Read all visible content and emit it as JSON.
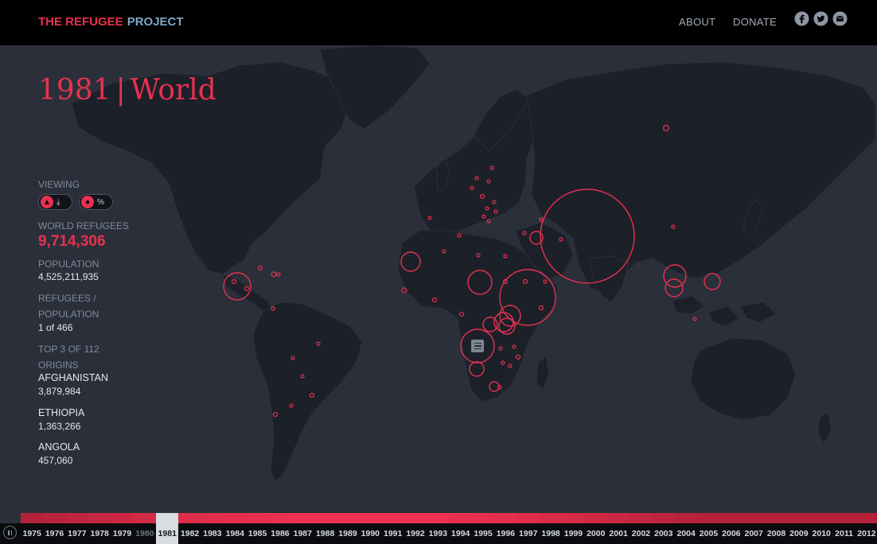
{
  "header": {
    "logo_part1": "THE REFUGEE",
    "logo_part2": "PROJECT",
    "nav": [
      "ABOUT",
      "DONATE"
    ],
    "social": [
      "facebook-icon",
      "twitter-icon",
      "email-icon"
    ]
  },
  "title": {
    "year": "1981",
    "separator": "|",
    "region": "World"
  },
  "panel": {
    "viewing_label": "VIEWING",
    "world_refugees_label": "WORLD REFUGEES",
    "world_refugees_value": "9,714,306",
    "population_label": "POPULATION",
    "population_value": "4,525,211,935",
    "ratio_label_1": "REFUGEES /",
    "ratio_label_2": "POPULATION",
    "ratio_value": "1 of 466",
    "top_label": "TOP 3 OF 112",
    "origins_label": "ORIGINS",
    "origins": [
      {
        "name": "AFGHANISTAN",
        "value": "3,879,984"
      },
      {
        "name": "ETHIOPIA",
        "value": "1,363,266"
      },
      {
        "name": "ANGOLA",
        "value": "457,060"
      }
    ]
  },
  "timeline": {
    "years": [
      "1975",
      "1976",
      "1977",
      "1978",
      "1979",
      "1980",
      "1981",
      "1982",
      "1983",
      "1984",
      "1985",
      "1986",
      "1987",
      "1988",
      "1989",
      "1990",
      "1991",
      "1992",
      "1993",
      "1994",
      "1995",
      "1996",
      "1997",
      "1998",
      "1999",
      "2000",
      "2001",
      "2002",
      "2003",
      "2004",
      "2005",
      "2006",
      "2007",
      "2008",
      "2009",
      "2010",
      "2011",
      "2012"
    ],
    "selected": "1981"
  },
  "colors": {
    "accent": "#e8314f",
    "logo_secondary": "#7aa7c9",
    "background": "#2a2f3a",
    "land": "#1c2029",
    "header_bg": "#000000"
  }
}
